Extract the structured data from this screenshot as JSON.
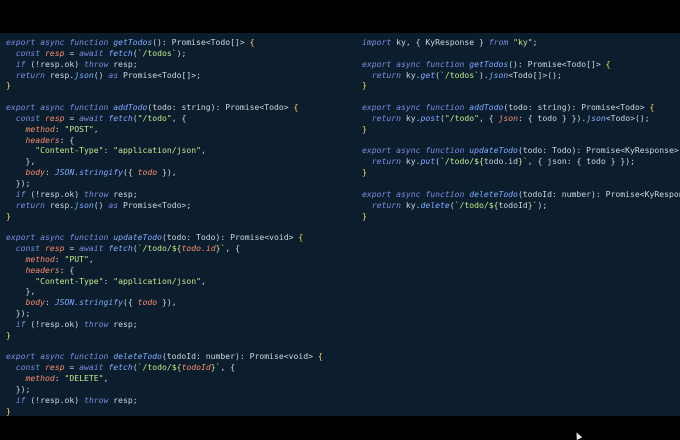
{
  "left_code": [
    [
      [
        "kw",
        "export async function "
      ],
      [
        "fn",
        "getTodos"
      ],
      [
        "plain",
        "(): Promise<Todo[]> "
      ],
      [
        "br",
        "{"
      ]
    ],
    [
      [
        "plain",
        "  "
      ],
      [
        "kw",
        "const "
      ],
      [
        "prop",
        "resp"
      ],
      [
        "plain",
        " = "
      ],
      [
        "kw",
        "await "
      ],
      [
        "fn",
        "fetch"
      ],
      [
        "plain",
        "("
      ],
      [
        "str",
        "`/todos`"
      ],
      [
        "plain",
        ");"
      ]
    ],
    [
      [
        "plain",
        "  "
      ],
      [
        "kw",
        "if "
      ],
      [
        "plain",
        "(!resp.ok) "
      ],
      [
        "kw",
        "throw "
      ],
      [
        "plain",
        "resp;"
      ]
    ],
    [
      [
        "plain",
        "  "
      ],
      [
        "kw",
        "return "
      ],
      [
        "plain",
        "resp."
      ],
      [
        "fn",
        "json"
      ],
      [
        "plain",
        "() "
      ],
      [
        "kw",
        "as "
      ],
      [
        "plain",
        "Promise<Todo[]>;"
      ]
    ],
    [
      [
        "br",
        "}"
      ]
    ],
    [],
    [
      [
        "kw",
        "export async function "
      ],
      [
        "fn",
        "addTodo"
      ],
      [
        "plain",
        "(todo: string): Promise<Todo> "
      ],
      [
        "br",
        "{"
      ]
    ],
    [
      [
        "plain",
        "  "
      ],
      [
        "kw",
        "const "
      ],
      [
        "prop",
        "resp"
      ],
      [
        "plain",
        " = "
      ],
      [
        "kw",
        "await "
      ],
      [
        "fn",
        "fetch"
      ],
      [
        "plain",
        "("
      ],
      [
        "str",
        "\"/todo\""
      ],
      [
        "plain",
        ", {"
      ]
    ],
    [
      [
        "plain",
        "    "
      ],
      [
        "prop",
        "method"
      ],
      [
        "plain",
        ": "
      ],
      [
        "str",
        "\"POST\""
      ],
      [
        "plain",
        ","
      ]
    ],
    [
      [
        "plain",
        "    "
      ],
      [
        "prop",
        "headers"
      ],
      [
        "plain",
        ": {"
      ]
    ],
    [
      [
        "plain",
        "      "
      ],
      [
        "str",
        "\"Content-Type\""
      ],
      [
        "plain",
        ": "
      ],
      [
        "str",
        "\"application/json\""
      ],
      [
        "plain",
        ","
      ]
    ],
    [
      [
        "plain",
        "    },"
      ]
    ],
    [
      [
        "plain",
        "    "
      ],
      [
        "prop",
        "body"
      ],
      [
        "plain",
        ": "
      ],
      [
        "fn",
        "JSON.stringify"
      ],
      [
        "plain",
        "({ "
      ],
      [
        "prop",
        "todo"
      ],
      [
        "plain",
        " }),"
      ]
    ],
    [
      [
        "plain",
        "  });"
      ]
    ],
    [
      [
        "plain",
        "  "
      ],
      [
        "kw",
        "if "
      ],
      [
        "plain",
        "(!resp.ok) "
      ],
      [
        "kw",
        "throw "
      ],
      [
        "plain",
        "resp;"
      ]
    ],
    [
      [
        "plain",
        "  "
      ],
      [
        "kw",
        "return "
      ],
      [
        "plain",
        "resp."
      ],
      [
        "fn",
        "json"
      ],
      [
        "plain",
        "() "
      ],
      [
        "kw",
        "as "
      ],
      [
        "plain",
        "Promise<Todo>;"
      ]
    ],
    [
      [
        "br",
        "}"
      ]
    ],
    [],
    [
      [
        "kw",
        "export async function "
      ],
      [
        "fn",
        "updateTodo"
      ],
      [
        "plain",
        "(todo: Todo): Promise<void> "
      ],
      [
        "br",
        "{"
      ]
    ],
    [
      [
        "plain",
        "  "
      ],
      [
        "kw",
        "const "
      ],
      [
        "prop",
        "resp"
      ],
      [
        "plain",
        " = "
      ],
      [
        "kw",
        "await "
      ],
      [
        "fn",
        "fetch"
      ],
      [
        "plain",
        "("
      ],
      [
        "str",
        "`/todo/${"
      ],
      [
        "prop",
        "todo.id"
      ],
      [
        "str",
        "}`"
      ],
      [
        "plain",
        ", {"
      ]
    ],
    [
      [
        "plain",
        "    "
      ],
      [
        "prop",
        "method"
      ],
      [
        "plain",
        ": "
      ],
      [
        "str",
        "\"PUT\""
      ],
      [
        "plain",
        ","
      ]
    ],
    [
      [
        "plain",
        "    "
      ],
      [
        "prop",
        "headers"
      ],
      [
        "plain",
        ": {"
      ]
    ],
    [
      [
        "plain",
        "      "
      ],
      [
        "str",
        "\"Content-Type\""
      ],
      [
        "plain",
        ": "
      ],
      [
        "str",
        "\"application/json\""
      ],
      [
        "plain",
        ","
      ]
    ],
    [
      [
        "plain",
        "    },"
      ]
    ],
    [
      [
        "plain",
        "    "
      ],
      [
        "prop",
        "body"
      ],
      [
        "plain",
        ": "
      ],
      [
        "fn",
        "JSON.stringify"
      ],
      [
        "plain",
        "({ "
      ],
      [
        "prop",
        "todo"
      ],
      [
        "plain",
        " }),"
      ]
    ],
    [
      [
        "plain",
        "  });"
      ]
    ],
    [
      [
        "plain",
        "  "
      ],
      [
        "kw",
        "if "
      ],
      [
        "plain",
        "(!resp.ok) "
      ],
      [
        "kw",
        "throw "
      ],
      [
        "plain",
        "resp;"
      ]
    ],
    [
      [
        "br",
        "}"
      ]
    ],
    [],
    [
      [
        "kw",
        "export async function "
      ],
      [
        "fn",
        "deleteTodo"
      ],
      [
        "plain",
        "(todoId: number): Promise<void> "
      ],
      [
        "br",
        "{"
      ]
    ],
    [
      [
        "plain",
        "  "
      ],
      [
        "kw",
        "const "
      ],
      [
        "prop",
        "resp"
      ],
      [
        "plain",
        " = "
      ],
      [
        "kw",
        "await "
      ],
      [
        "fn",
        "fetch"
      ],
      [
        "plain",
        "("
      ],
      [
        "str",
        "`/todo/${"
      ],
      [
        "prop",
        "todoId"
      ],
      [
        "str",
        "}`"
      ],
      [
        "plain",
        ", {"
      ]
    ],
    [
      [
        "plain",
        "    "
      ],
      [
        "prop",
        "method"
      ],
      [
        "plain",
        ": "
      ],
      [
        "str",
        "\"DELETE\""
      ],
      [
        "plain",
        ","
      ]
    ],
    [
      [
        "plain",
        "  });"
      ]
    ],
    [
      [
        "plain",
        "  "
      ],
      [
        "kw",
        "if "
      ],
      [
        "plain",
        "(!resp.ok) "
      ],
      [
        "kw",
        "throw "
      ],
      [
        "plain",
        "resp;"
      ]
    ],
    [
      [
        "br",
        "}"
      ]
    ]
  ],
  "right_code": [
    [
      [
        "kw",
        "import "
      ],
      [
        "plain",
        "ky, { KyResponse } "
      ],
      [
        "kw",
        "from "
      ],
      [
        "str",
        "\"ky\""
      ],
      [
        "plain",
        ";"
      ]
    ],
    [],
    [
      [
        "kw",
        "export async function "
      ],
      [
        "fn",
        "getTodos"
      ],
      [
        "plain",
        "(): Promise<Todo[]> "
      ],
      [
        "br",
        "{"
      ]
    ],
    [
      [
        "plain",
        "  "
      ],
      [
        "kw",
        "return "
      ],
      [
        "plain",
        "ky."
      ],
      [
        "fn",
        "get"
      ],
      [
        "plain",
        "("
      ],
      [
        "str",
        "`/todos`"
      ],
      [
        "plain",
        ")."
      ],
      [
        "fn",
        "json"
      ],
      [
        "plain",
        "<Todo[]>();"
      ]
    ],
    [
      [
        "br",
        "}"
      ]
    ],
    [],
    [
      [
        "kw",
        "export async function "
      ],
      [
        "fn",
        "addTodo"
      ],
      [
        "plain",
        "(todo: string): Promise<Todo> "
      ],
      [
        "br",
        "{"
      ]
    ],
    [
      [
        "plain",
        "  "
      ],
      [
        "kw",
        "return "
      ],
      [
        "plain",
        "ky."
      ],
      [
        "fn",
        "post"
      ],
      [
        "plain",
        "("
      ],
      [
        "str",
        "\"/todo\""
      ],
      [
        "plain",
        ", { "
      ],
      [
        "prop",
        "json"
      ],
      [
        "plain",
        ": { todo } })."
      ],
      [
        "fn",
        "json"
      ],
      [
        "plain",
        "<Todo>();"
      ]
    ],
    [
      [
        "br",
        "}"
      ]
    ],
    [],
    [
      [
        "kw",
        "export async function "
      ],
      [
        "fn",
        "updateTodo"
      ],
      [
        "plain",
        "(todo: Todo): Promise<KyResponse> "
      ],
      [
        "br",
        "{"
      ]
    ],
    [
      [
        "plain",
        "  "
      ],
      [
        "kw",
        "return "
      ],
      [
        "plain",
        "ky."
      ],
      [
        "fn",
        "put"
      ],
      [
        "plain",
        "("
      ],
      [
        "str",
        "`/todo/${"
      ],
      [
        "plain",
        "todo.id"
      ],
      [
        "str",
        "}`"
      ],
      [
        "plain",
        ", { json: { todo } });"
      ]
    ],
    [
      [
        "br",
        "}"
      ]
    ],
    [],
    [
      [
        "kw",
        "export async function "
      ],
      [
        "fn",
        "deleteTodo"
      ],
      [
        "plain",
        "(todoId: number): Promise<KyResponse> "
      ],
      [
        "br",
        "{"
      ]
    ],
    [
      [
        "plain",
        "  "
      ],
      [
        "kw",
        "return "
      ],
      [
        "plain",
        "ky."
      ],
      [
        "fn",
        "delete"
      ],
      [
        "plain",
        "("
      ],
      [
        "str",
        "`/todo/${"
      ],
      [
        "plain",
        "todoId"
      ],
      [
        "str",
        "}`"
      ],
      [
        "plain",
        ");"
      ]
    ],
    [
      [
        "br",
        "}"
      ]
    ]
  ]
}
